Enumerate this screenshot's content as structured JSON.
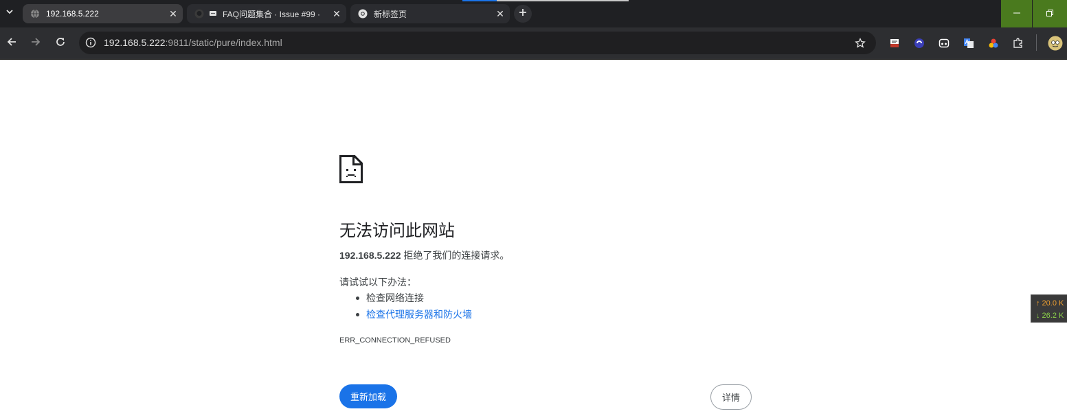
{
  "tabs": [
    {
      "title": "192.168.5.222",
      "active": true,
      "icon": "globe-icon"
    },
    {
      "title": "FAQ问题集合 · Issue #99 ·",
      "active": false,
      "icon": "github-icon"
    },
    {
      "title": "新标签页",
      "active": false,
      "icon": "chrome-icon"
    }
  ],
  "omnibox": {
    "host": "192.168.5.222",
    "rest": ":9811/static/pure/index.html"
  },
  "error": {
    "title": "无法访问此网站",
    "host": "192.168.5.222",
    "summary_suffix": " 拒绝了我们的连接请求。",
    "try_label": "请试试以下办法：",
    "suggestions": [
      "检查网络连接",
      "检查代理服务器和防火墙"
    ],
    "code": "ERR_CONNECTION_REFUSED",
    "reload_label": "重新加载",
    "details_label": "详情"
  },
  "netspeed": {
    "up": "↑ 20.0 K",
    "down": "↓ 26.2 K"
  },
  "colors": {
    "accent": "#1a73e8",
    "tabstrip": "#1f2023",
    "toolbar": "#2d2e31",
    "window_controls": "#4a7a1e"
  }
}
